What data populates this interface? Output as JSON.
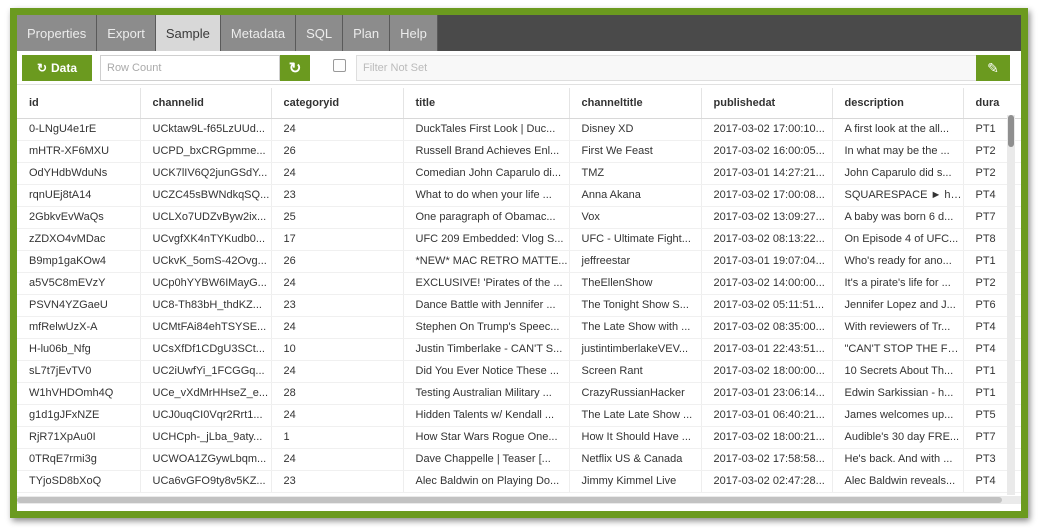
{
  "tabs": [
    {
      "label": "Properties"
    },
    {
      "label": "Export"
    },
    {
      "label": "Sample"
    },
    {
      "label": "Metadata"
    },
    {
      "label": "SQL"
    },
    {
      "label": "Plan"
    },
    {
      "label": "Help"
    }
  ],
  "toolbar": {
    "data_label": "Data",
    "row_count_placeholder": "Row Count",
    "filter_placeholder": "Filter Not Set"
  },
  "columns": [
    "id",
    "channelid",
    "categoryid",
    "title",
    "channeltitle",
    "publishedat",
    "description",
    "dura"
  ],
  "rows": [
    [
      "0-LNgU4e1rE",
      "UCktaw9L-f65LzUUd...",
      "24",
      "DuckTales First Look | Duc...",
      "Disney XD",
      "2017-03-02 17:00:10...",
      "A first look at the all...",
      "PT1"
    ],
    [
      "mHTR-XF6MXU",
      "UCPD_bxCRGpmme...",
      "26",
      "Russell Brand Achieves Enl...",
      "First We Feast",
      "2017-03-02 16:00:05...",
      "In what may be the ...",
      "PT2"
    ],
    [
      "OdYHdbWduNs",
      "UCK7lIV6Q2junGSdY...",
      "24",
      "Comedian John Caparulo di...",
      "TMZ",
      "2017-03-01 14:27:21...",
      "John Caparulo did s...",
      "PT2"
    ],
    [
      "rqnUEj8tA14",
      "UCZC45sBWNdkqSQ...",
      "23",
      "What to do when your life ...",
      "Anna Akana",
      "2017-03-02 17:00:08...",
      "SQUARESPACE ► ht...",
      "PT4"
    ],
    [
      "2GbkvEvWaQs",
      "UCLXo7UDZvByw2ix...",
      "25",
      "One paragraph of Obamac...",
      "Vox",
      "2017-03-02 13:09:27...",
      "A baby was born 6 d...",
      "PT7"
    ],
    [
      "zZDXO4vMDac",
      "UCvgfXK4nTYKudb0...",
      "17",
      "UFC 209 Embedded: Vlog S...",
      "UFC - Ultimate Fight...",
      "2017-03-02 08:13:22...",
      "On Episode 4 of UFC...",
      "PT8"
    ],
    [
      "B9mp1gaKOw4",
      "UCkvK_5omS-42Ovg...",
      "26",
      "*NEW* MAC RETRO MATTE...",
      "jeffreestar",
      "2017-03-01 19:07:04...",
      "Who's ready for ano...",
      "PT1"
    ],
    [
      "a5V5C8mEVzY",
      "UCp0hYYBW6IMayG...",
      "24",
      "EXCLUSIVE! 'Pirates of the ...",
      "TheEllenShow",
      "2017-03-02 14:00:00...",
      "It's a pirate's life for ...",
      "PT2"
    ],
    [
      "PSVN4YZGaeU",
      "UC8-Th83bH_thdKZ...",
      "23",
      "Dance Battle with Jennifer ...",
      "The Tonight Show S...",
      "2017-03-02 05:11:51...",
      "Jennifer Lopez and J...",
      "PT6"
    ],
    [
      "mfRelwUzX-A",
      "UCMtFAi84ehTSYSE...",
      "24",
      "Stephen On Trump's Speec...",
      "The Late Show with ...",
      "2017-03-02 08:35:00...",
      "With reviewers of Tr...",
      "PT4"
    ],
    [
      "H-lu06b_Nfg",
      "UCsXfDf1CDgU3SCt...",
      "10",
      "Justin Timberlake - CAN'T S...",
      "justintimberlakeVEV...",
      "2017-03-01 22:43:51...",
      "\"CAN'T STOP THE FE...",
      "PT4"
    ],
    [
      "sL7t7jEvTV0",
      "UC2iUwfYi_1FCGGq...",
      "24",
      "Did You Ever Notice These ...",
      "Screen Rant",
      "2017-03-02 18:00:00...",
      "10 Secrets About Th...",
      "PT1"
    ],
    [
      "W1hVHDOmh4Q",
      "UCe_vXdMrHHseZ_e...",
      "28",
      "Testing Australian Military ...",
      "CrazyRussianHacker",
      "2017-03-01 23:06:14...",
      "Edwin Sarkissian - h...",
      "PT1"
    ],
    [
      "g1d1gJFxNZE",
      "UCJ0uqCI0Vqr2Rrt1...",
      "24",
      "Hidden Talents w/ Kendall ...",
      "The Late Late Show ...",
      "2017-03-01 06:40:21...",
      "James welcomes up...",
      "PT5"
    ],
    [
      "RjR71XpAu0I",
      "UCHCph-_jLba_9aty...",
      "1",
      "How Star Wars Rogue One...",
      "How It Should Have ...",
      "2017-03-02 18:00:21...",
      "Audible's 30 day FRE...",
      "PT7"
    ],
    [
      "0TRqE7rmi3g",
      "UCWOA1ZGywLbqm...",
      "24",
      "Dave Chappelle | Teaser [...",
      "Netflix US & Canada",
      "2017-03-02 17:58:58...",
      "He's back. And with ...",
      "PT3"
    ],
    [
      "TYjoSD8bXoQ",
      "UCa6vGFO9ty8v5KZ...",
      "23",
      "Alec Baldwin on Playing Do...",
      "Jimmy Kimmel Live",
      "2017-03-02 02:47:28...",
      "Alec Baldwin reveals...",
      "PT4"
    ]
  ]
}
